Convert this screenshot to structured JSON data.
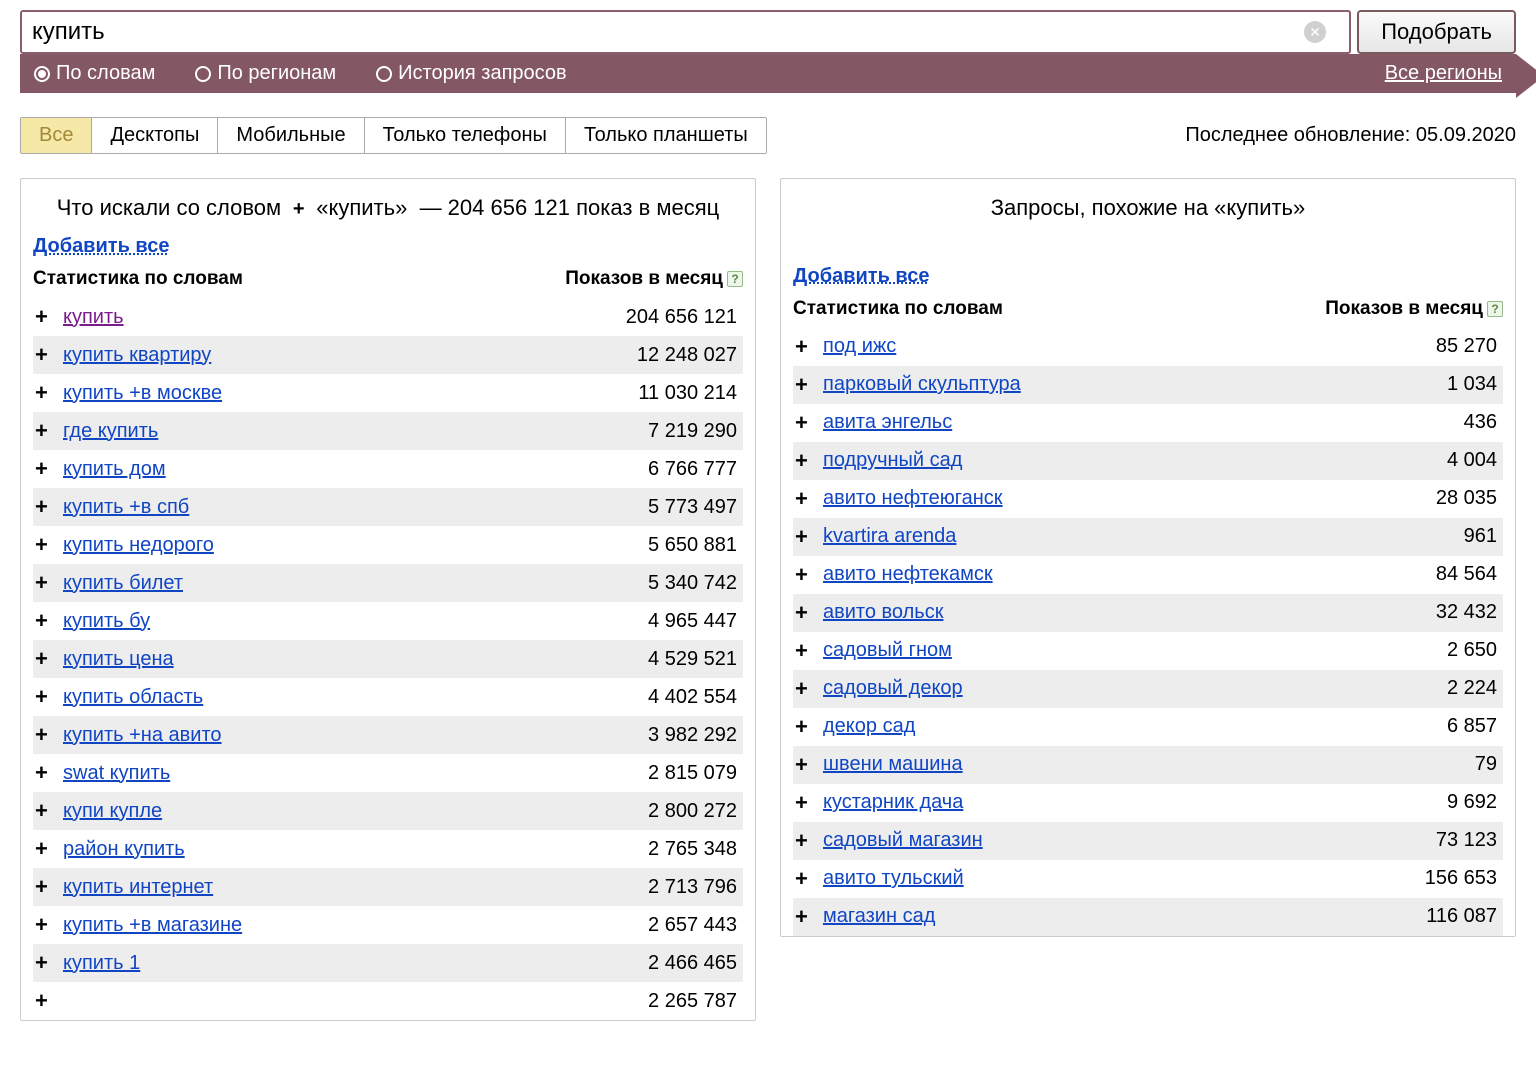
{
  "search": {
    "value": "купить",
    "submit_label": "Подобрать"
  },
  "filters": {
    "by_words": "По словам",
    "by_regions": "По регионам",
    "history": "История запросов",
    "all_regions": "Все регионы"
  },
  "devices": {
    "tabs": [
      "Все",
      "Десктопы",
      "Мобильные",
      "Только телефоны",
      "Только планшеты"
    ],
    "last_update_label": "Последнее обновление: 05.09.2020"
  },
  "left": {
    "title_prefix": "Что искали со словом",
    "title_query": "«купить»",
    "title_suffix": "— 204 656 121 показ в месяц",
    "add_all": "Добавить все",
    "col_stat": "Статистика по словам",
    "col_count": "Показов в месяц",
    "rows": [
      {
        "term": "купить",
        "count": "204 656 121",
        "visited": true
      },
      {
        "term": "купить квартиру",
        "count": "12 248 027"
      },
      {
        "term": "купить +в москве",
        "count": "11 030 214"
      },
      {
        "term": "где купить",
        "count": "7 219 290"
      },
      {
        "term": "купить дом",
        "count": "6 766 777"
      },
      {
        "term": "купить +в спб",
        "count": "5 773 497"
      },
      {
        "term": "купить недорого",
        "count": "5 650 881"
      },
      {
        "term": "купить билет",
        "count": "5 340 742"
      },
      {
        "term": "купить бу",
        "count": "4 965 447"
      },
      {
        "term": "купить цена",
        "count": "4 529 521"
      },
      {
        "term": "купить область",
        "count": "4 402 554"
      },
      {
        "term": "купить +на авито",
        "count": "3 982 292"
      },
      {
        "term": "swat купить",
        "count": "2 815 079"
      },
      {
        "term": "купи купле",
        "count": "2 800 272"
      },
      {
        "term": "район купить",
        "count": "2 765 348"
      },
      {
        "term": "купить интернет",
        "count": "2 713 796"
      },
      {
        "term": "купить +в магазине",
        "count": "2 657 443"
      },
      {
        "term": "купить 1",
        "count": "2 466 465"
      },
      {
        "term": "",
        "count": "2 265 787"
      }
    ]
  },
  "right": {
    "title": "Запросы, похожие на «купить»",
    "add_all": "Добавить все",
    "col_stat": "Статистика по словам",
    "col_count": "Показов в месяц",
    "rows": [
      {
        "term": "под ижс",
        "count": "85 270"
      },
      {
        "term": "парковый скульптура",
        "count": "1 034"
      },
      {
        "term": "авита энгельс",
        "count": "436"
      },
      {
        "term": "подручный сад",
        "count": "4 004"
      },
      {
        "term": "авито нефтеюганск",
        "count": "28 035"
      },
      {
        "term": "kvartira arenda",
        "count": "961"
      },
      {
        "term": "авито нефтекамск",
        "count": "84 564"
      },
      {
        "term": "авито вольск",
        "count": "32 432"
      },
      {
        "term": "садовый гном",
        "count": "2 650"
      },
      {
        "term": "садовый декор",
        "count": "2 224"
      },
      {
        "term": "декор сад",
        "count": "6 857"
      },
      {
        "term": "швени машина",
        "count": "79"
      },
      {
        "term": "кустарник дача",
        "count": "9 692"
      },
      {
        "term": "садовый магазин",
        "count": "73 123"
      },
      {
        "term": "авито тульский",
        "count": "156 653"
      },
      {
        "term": "магазин сад",
        "count": "116 087"
      }
    ]
  }
}
